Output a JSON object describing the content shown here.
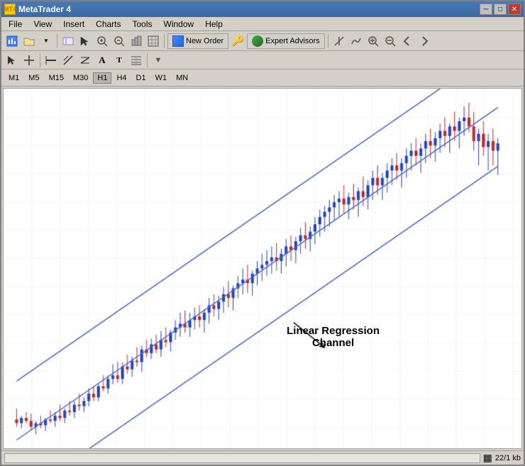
{
  "window": {
    "title": "MetaTrader 4",
    "icon": "MT4"
  },
  "title_controls": {
    "minimize": "─",
    "maximize": "□",
    "close": "✕"
  },
  "menu": {
    "items": [
      "File",
      "View",
      "Insert",
      "Charts",
      "Tools",
      "Window",
      "Help"
    ]
  },
  "toolbar1": {
    "new_order_label": "New Order",
    "expert_advisors_label": "Expert Advisors"
  },
  "timeframes": {
    "items": [
      "M1",
      "M5",
      "M15",
      "M30",
      "H1",
      "H4",
      "D1",
      "W1",
      "MN"
    ],
    "active": "H1"
  },
  "chart": {
    "annotation_line1": "Linear Regression",
    "annotation_line2": "Channel"
  },
  "status": {
    "info": "22/1 kb"
  }
}
